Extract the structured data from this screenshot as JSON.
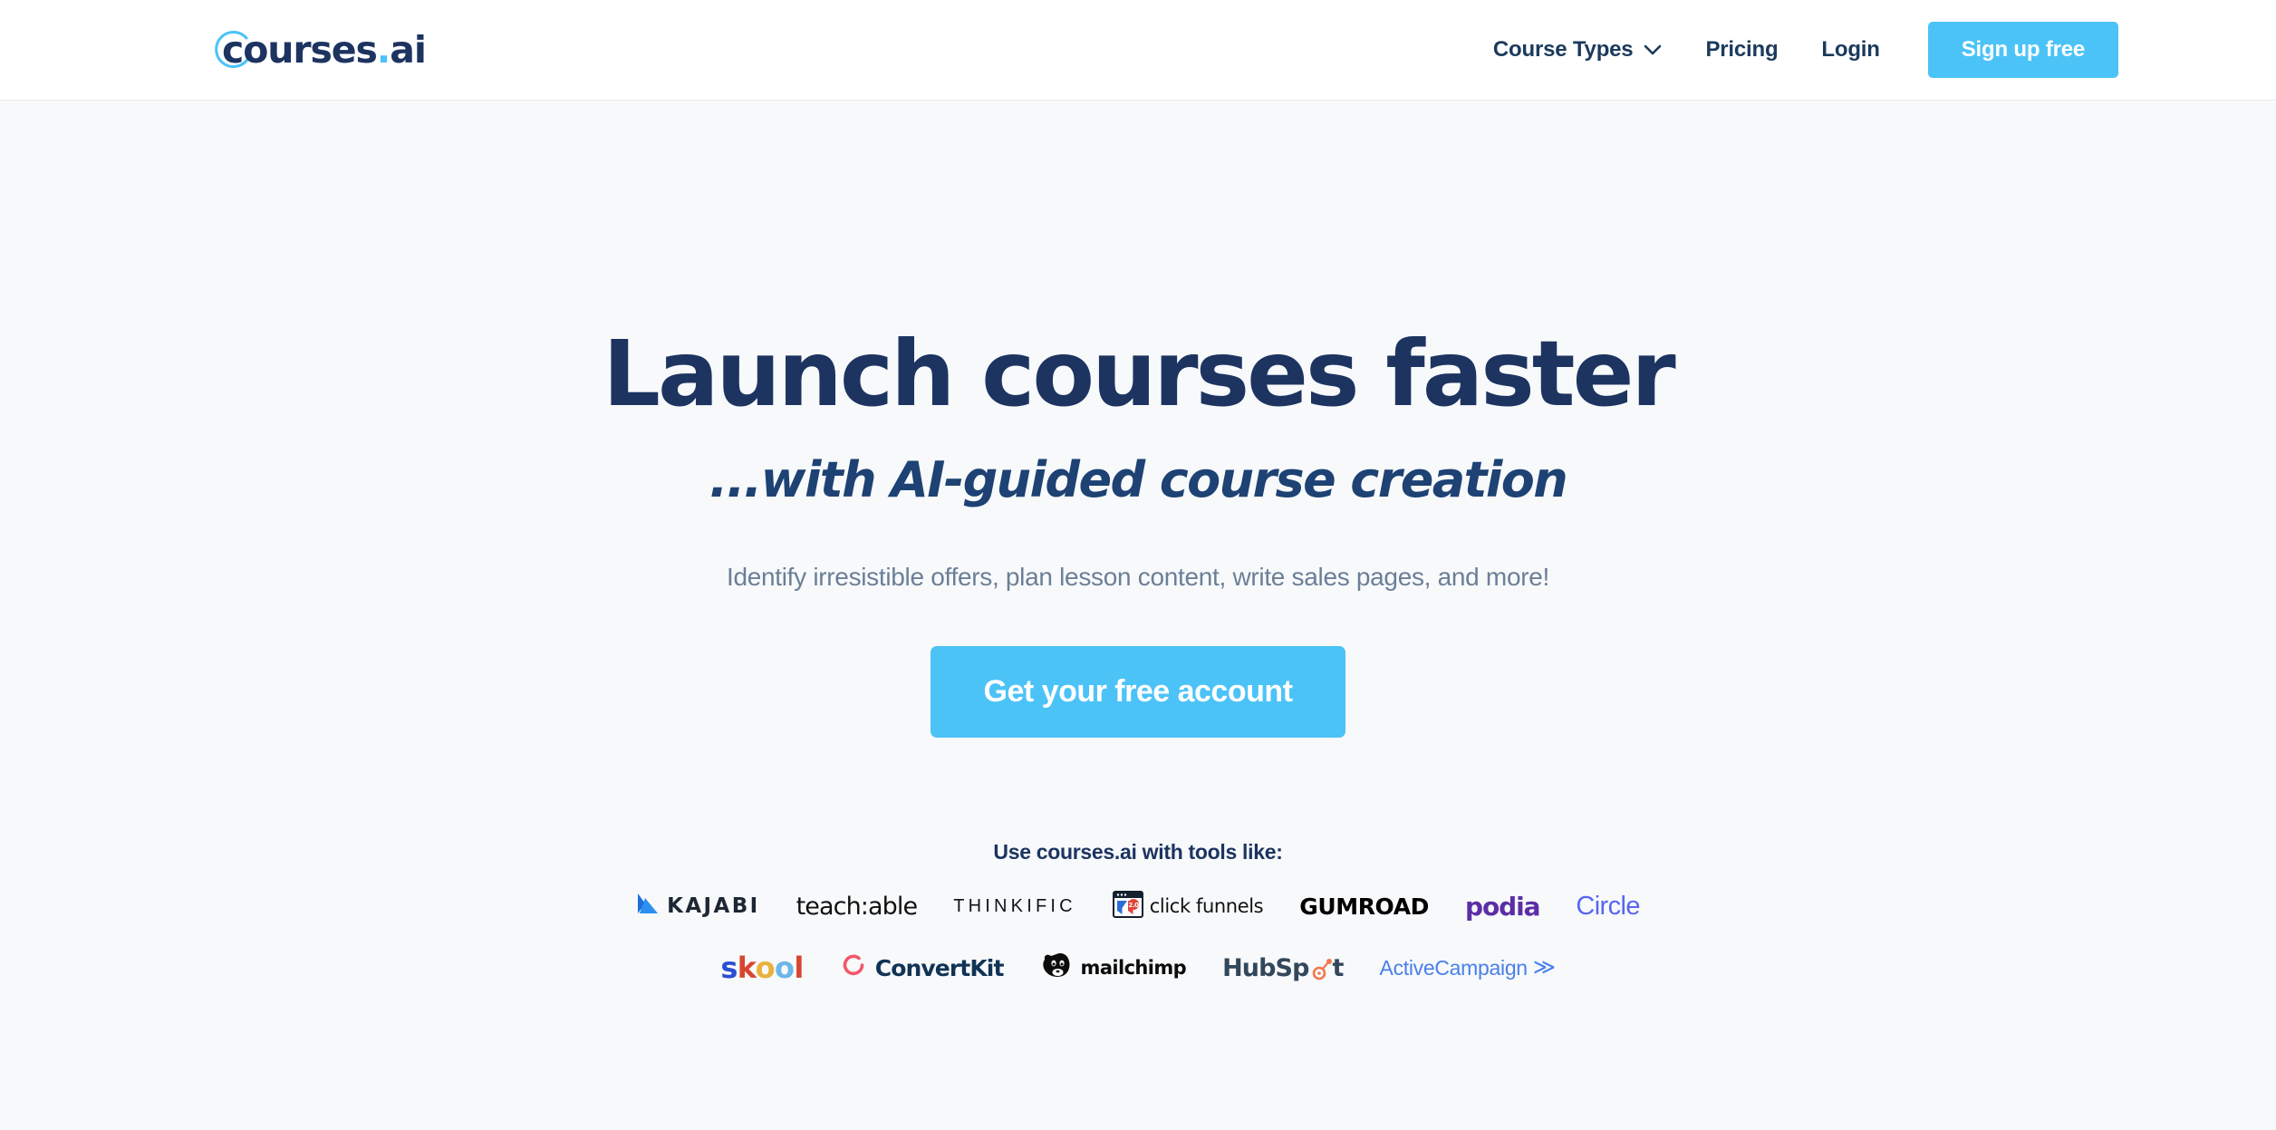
{
  "header": {
    "logo": {
      "text_main": "courses",
      "text_dot": ".",
      "text_suffix": "ai",
      "mark_color": "#4cc3f7",
      "text_color": "#1d3461"
    },
    "nav": [
      {
        "label": "Course Types",
        "has_dropdown": true
      },
      {
        "label": "Pricing",
        "has_dropdown": false
      },
      {
        "label": "Login",
        "has_dropdown": false
      }
    ],
    "signup_button": {
      "label": "Sign up free",
      "bg_color": "#4cc3f7",
      "text_color": "#ffffff"
    }
  },
  "hero": {
    "title": "Launch courses faster",
    "subtitle": "...with AI-guided course creation",
    "description": "Identify irresistible offers, plan lesson content, write sales pages, and more!",
    "cta_button": {
      "label": "Get your free account",
      "bg_color": "#4cc3f7",
      "text_color": "#ffffff"
    },
    "background_color": "#f7f9fb"
  },
  "tools": {
    "heading": "Use courses.ai with tools like:",
    "row1": [
      {
        "name": "Kajabi",
        "label": "KAJABI",
        "color": "#1d2733"
      },
      {
        "name": "Teachable",
        "label": "teach:able",
        "color": "#111111"
      },
      {
        "name": "Thinkific",
        "label": "THINKIFIC",
        "color": "#12131a"
      },
      {
        "name": "ClickFunnels",
        "label": "click funnels",
        "color": "#111111",
        "badge": "2.0"
      },
      {
        "name": "Gumroad",
        "label": "GUMROAD",
        "color": "#000000"
      },
      {
        "name": "Podia",
        "label": "podia",
        "color": "#5c2ea6"
      },
      {
        "name": "Circle",
        "label": "Circle",
        "color": "#5865f2"
      }
    ],
    "row2": [
      {
        "name": "Skool",
        "label": "skool",
        "letters": [
          "s",
          "k",
          "o",
          "o",
          "l"
        ]
      },
      {
        "name": "ConvertKit",
        "label": "ConvertKit",
        "color": "#113355"
      },
      {
        "name": "Mailchimp",
        "label": "mailchimp",
        "color": "#0c0c0c"
      },
      {
        "name": "HubSpot",
        "label_a": "HubSp",
        "label_b": "t",
        "color": "#33475b"
      },
      {
        "name": "ActiveCampaign",
        "label": "ActiveCampaign",
        "color": "#4a7fea",
        "chevron": "≫"
      }
    ]
  }
}
